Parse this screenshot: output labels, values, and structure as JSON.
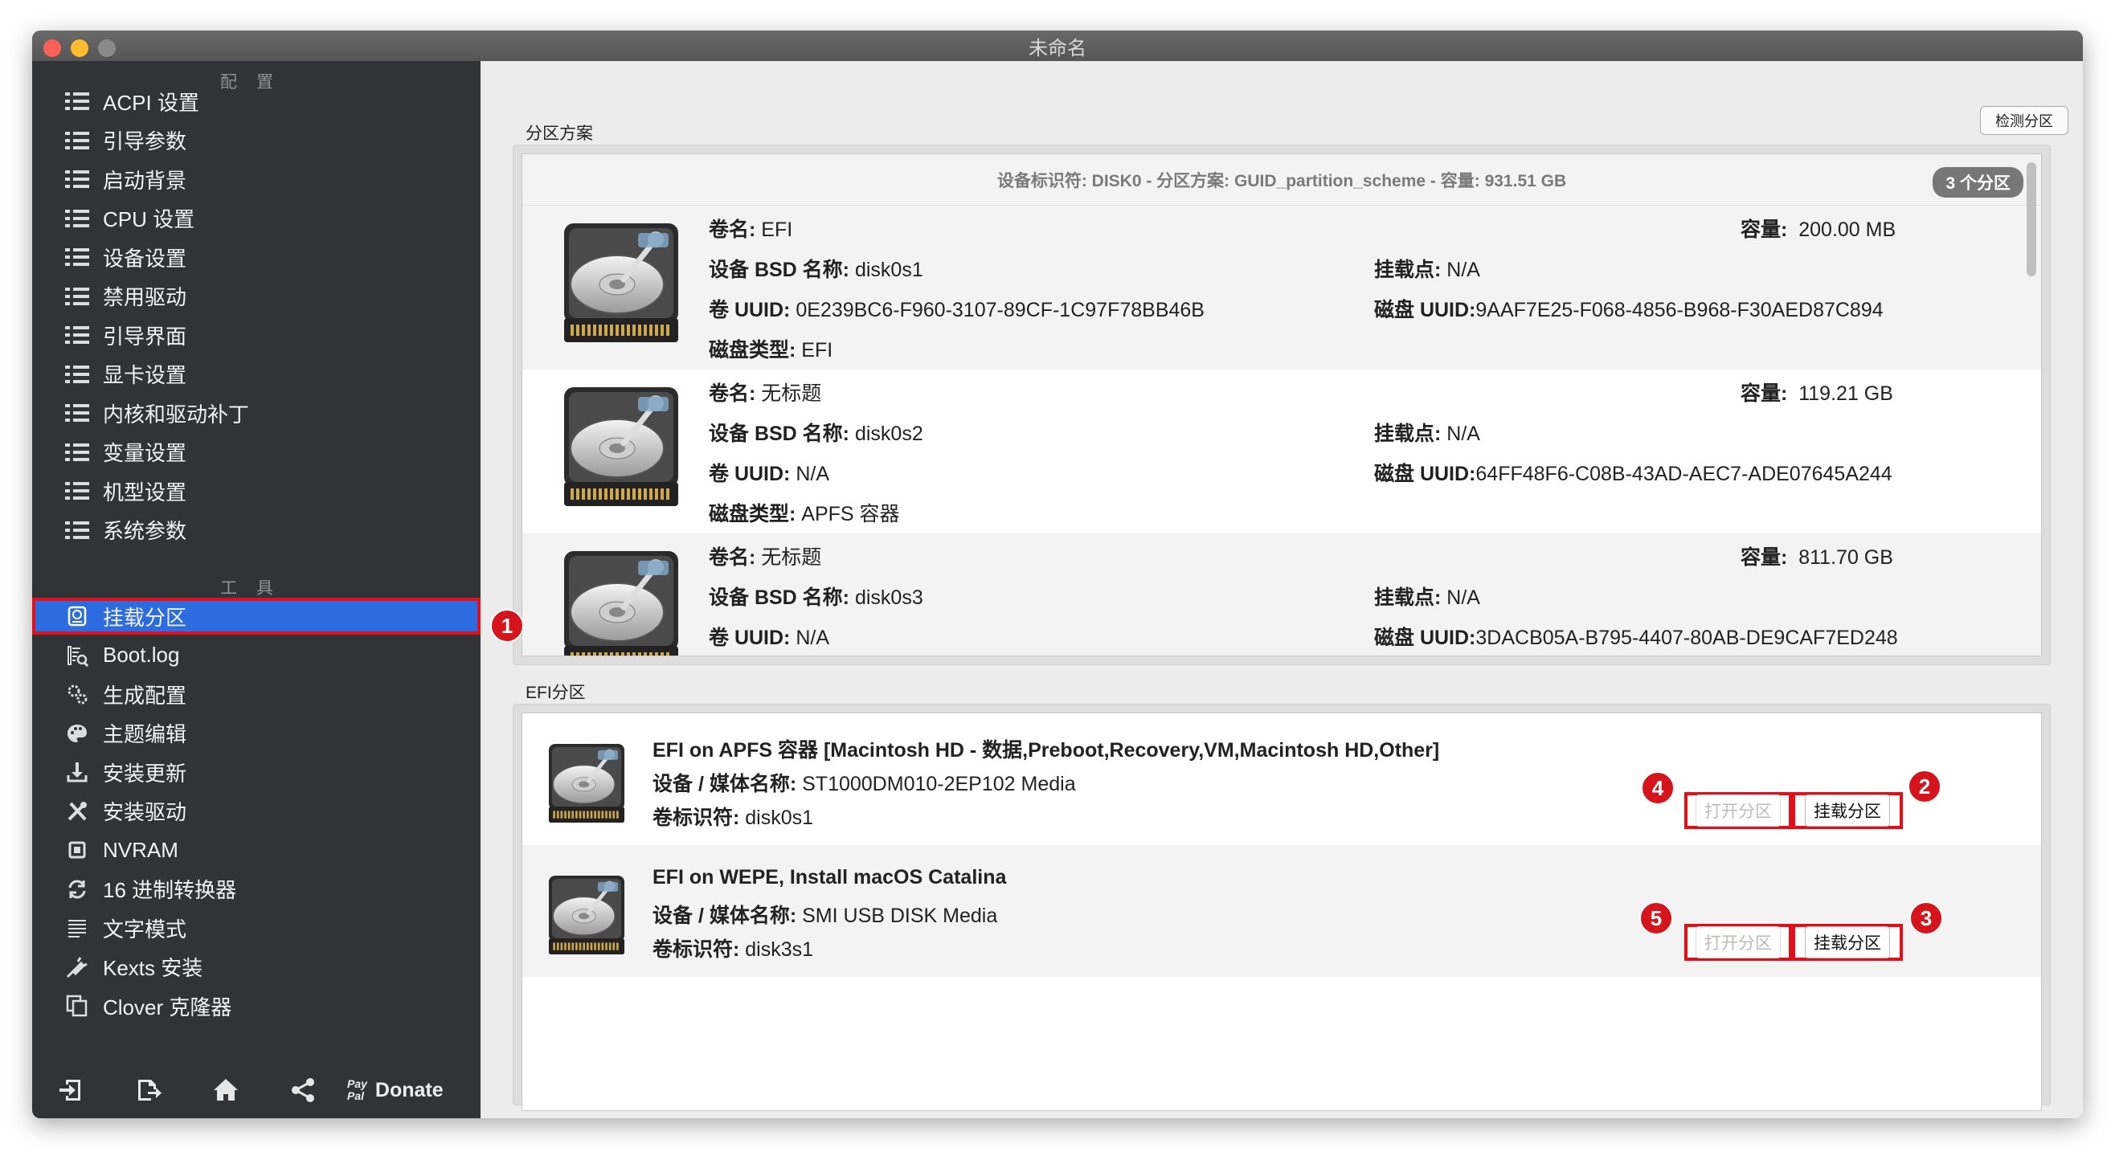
{
  "window": {
    "title": "未命名"
  },
  "sidebar": {
    "config_header": "配置",
    "config_items": [
      "ACPI 设置",
      "引导参数",
      "启动背景",
      "CPU 设置",
      "设备设置",
      "禁用驱动",
      "引导界面",
      "显卡设置",
      "内核和驱动补丁",
      "变量设置",
      "机型设置",
      "系统参数"
    ],
    "tools_header": "工具",
    "tool_items": [
      {
        "label": "挂载分区",
        "icon": "disk-icon",
        "selected": true
      },
      {
        "label": "Boot.log",
        "icon": "log-icon"
      },
      {
        "label": "生成配置",
        "icon": "gears-icon"
      },
      {
        "label": "主题编辑",
        "icon": "palette-icon"
      },
      {
        "label": "安装更新",
        "icon": "download-icon"
      },
      {
        "label": "安装驱动",
        "icon": "tools-icon"
      },
      {
        "label": "NVRAM",
        "icon": "chip-icon"
      },
      {
        "label": "16 进制转换器",
        "icon": "refresh-icon"
      },
      {
        "label": "文字模式",
        "icon": "text-icon"
      },
      {
        "label": "Kexts 安装",
        "icon": "plug-icon"
      },
      {
        "label": "Clover 克隆器",
        "icon": "copy-icon"
      }
    ],
    "bottom": {
      "donate_label": "Donate",
      "paypal_top": "Pay",
      "paypal_bottom": "Pal"
    }
  },
  "partition_scheme": {
    "group_label": "分区方案",
    "detect_button": "检测分区",
    "header_text": "设备标识符: DISK0 - 分区方案: GUID_partition_scheme - 容量: 931.51 GB",
    "badge": "3 个分区",
    "labels": {
      "volume": "卷名:",
      "bsd": "设备 BSD 名称:",
      "uuid": "卷 UUID:",
      "disk_type": "磁盘类型:",
      "capacity": "容量:",
      "mount": "挂载点:",
      "disk_uuid": "磁盘 UUID:"
    },
    "partitions": [
      {
        "volume": "EFI",
        "bsd": "disk0s1",
        "uuid": "0E239BC6-F960-3107-89CF-1C97F78BB46B",
        "disk_type": "EFI",
        "capacity": "200.00 MB",
        "mount": "N/A",
        "disk_uuid": "9AAF7E25-F068-4856-B968-F30AED87C894"
      },
      {
        "volume": "无标题",
        "bsd": "disk0s2",
        "uuid": "N/A",
        "disk_type": "APFS 容器",
        "capacity": "119.21 GB",
        "mount": "N/A",
        "disk_uuid": "64FF48F6-C08B-43AD-AEC7-ADE07645A244"
      },
      {
        "volume": "无标题",
        "bsd": "disk0s3",
        "uuid": "N/A",
        "disk_type": "",
        "capacity": "811.70 GB",
        "mount": "N/A",
        "disk_uuid": "3DACB05A-B795-4407-80AB-DE9CAF7ED248"
      }
    ]
  },
  "efi": {
    "group_label": "EFI分区",
    "open_label": "打开分区",
    "mount_label": "挂载分区",
    "media_label": "设备 / 媒体名称:",
    "id_label": "卷标识符:",
    "items": [
      {
        "title": "EFI on APFS 容器 [Macintosh HD - 数据,Preboot,Recovery,VM,Macintosh HD,Other]",
        "media": "ST1000DM010-2EP102 Media",
        "id": "disk0s1"
      },
      {
        "title": "EFI on WEPE, Install macOS Catalina",
        "media": "SMI USB DISK Media",
        "id": "disk3s1"
      }
    ]
  },
  "callouts": [
    "1",
    "2",
    "3",
    "4",
    "5"
  ],
  "colors": {
    "sidebar_bg": "#313336",
    "selected": "#2d6be0",
    "callout": "#d6141c"
  }
}
